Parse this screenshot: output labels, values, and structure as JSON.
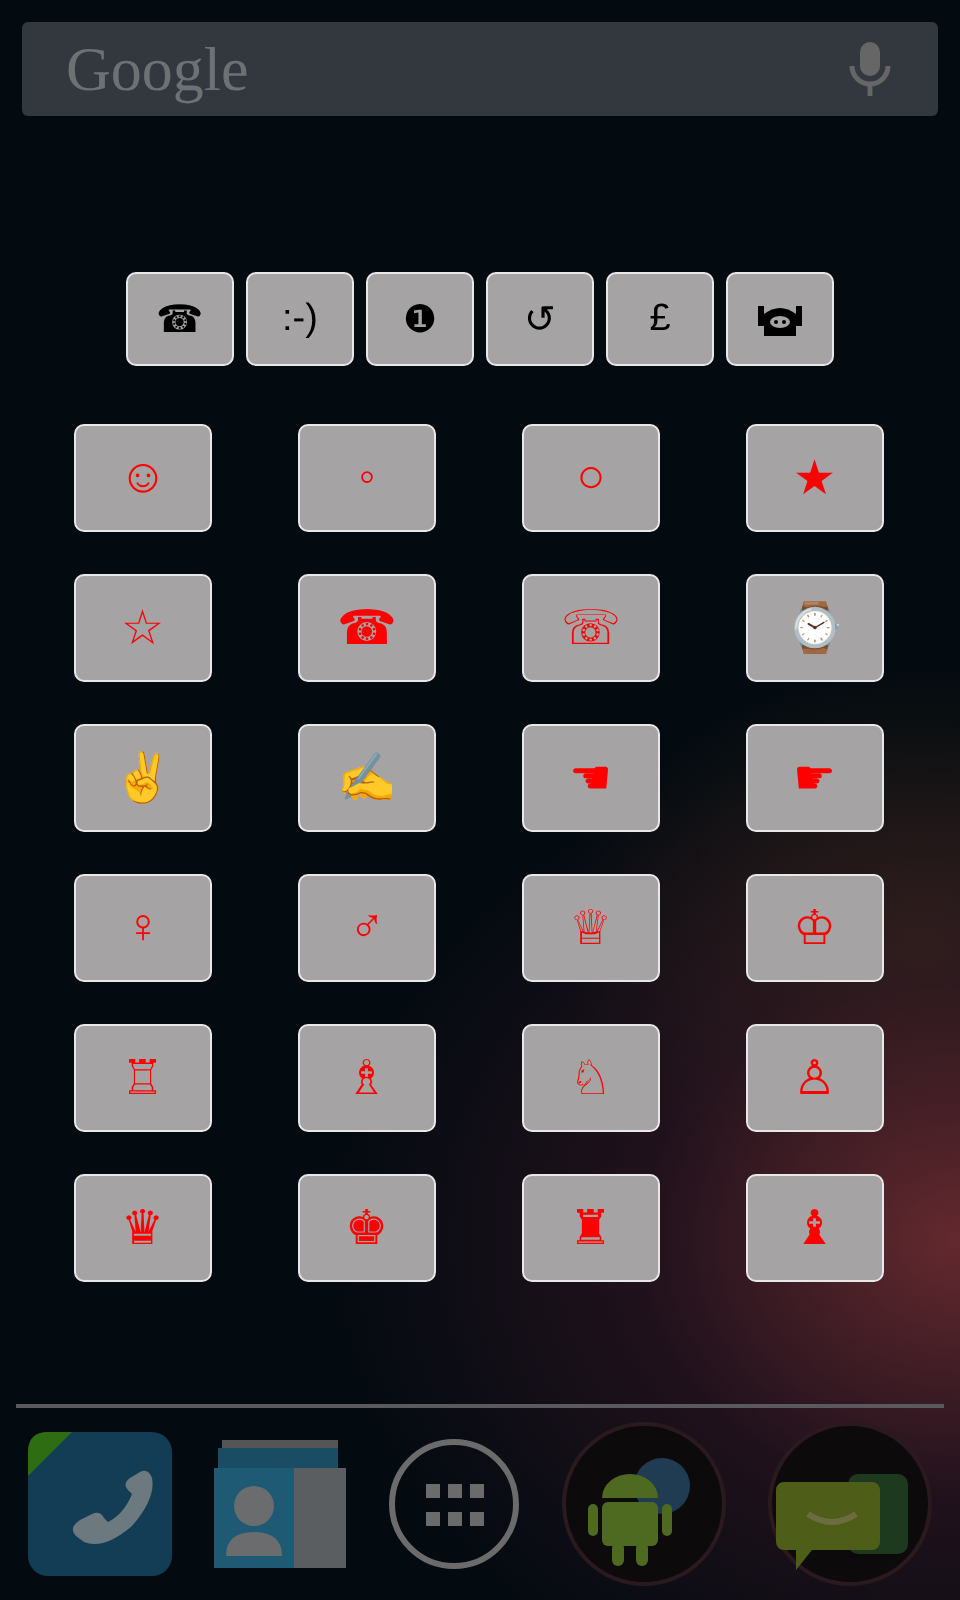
{
  "search_bar": {
    "logo": "Google"
  },
  "top_row": [
    {
      "kind": "text",
      "label": "☎"
    },
    {
      "kind": "text",
      "label": ":-)"
    },
    {
      "kind": "text",
      "label": "❶"
    },
    {
      "kind": "text",
      "label": "↺"
    },
    {
      "kind": "text",
      "label": "£"
    },
    {
      "kind": "icon"
    }
  ],
  "symbol_grid": [
    {
      "label": "☺"
    },
    {
      "label": "◦"
    },
    {
      "label": "○"
    },
    {
      "label": "★"
    },
    {
      "label": "☆"
    },
    {
      "label": "☎"
    },
    {
      "label": "☏"
    },
    {
      "label": "⌚"
    },
    {
      "label": "✌"
    },
    {
      "label": "✍"
    },
    {
      "label": "☚"
    },
    {
      "label": "☛"
    },
    {
      "label": "♀"
    },
    {
      "label": "♂"
    },
    {
      "label": "♕"
    },
    {
      "label": "♔"
    },
    {
      "label": "♖"
    },
    {
      "label": "♗"
    },
    {
      "label": "♘"
    },
    {
      "label": "♙"
    },
    {
      "label": "♛"
    },
    {
      "label": "♚"
    },
    {
      "label": "♜"
    },
    {
      "label": "♝"
    }
  ],
  "dock": [
    {
      "kind": "phone"
    },
    {
      "kind": "contacts"
    },
    {
      "kind": "apps"
    },
    {
      "kind": "android"
    },
    {
      "kind": "messaging"
    }
  ]
}
